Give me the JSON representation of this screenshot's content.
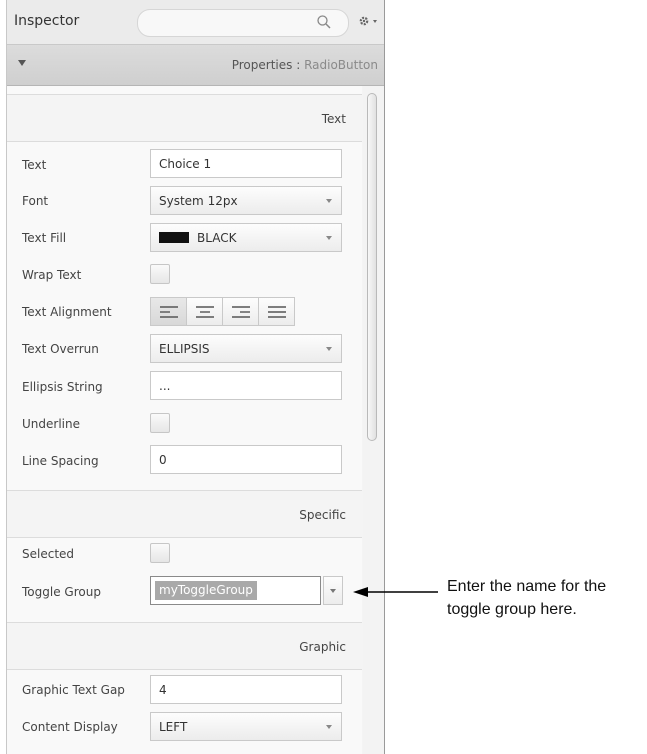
{
  "header": {
    "title": "Inspector",
    "search_icon": "magnifier",
    "settings_icon": "gear-with-dropdown"
  },
  "properties_bar": {
    "label": "Properties :",
    "type": "RadioButton"
  },
  "sections": {
    "text": {
      "title": "Text",
      "rows": {
        "text": {
          "label": "Text",
          "value": "Choice 1"
        },
        "font": {
          "label": "Font",
          "value": "System 12px"
        },
        "text_fill": {
          "label": "Text Fill",
          "value": "BLACK",
          "swatch_color": "#111111"
        },
        "wrap_text": {
          "label": "Wrap Text"
        },
        "text_alignment": {
          "label": "Text Alignment",
          "options": [
            "left",
            "center",
            "right",
            "justify"
          ],
          "selected": "left"
        },
        "text_overrun": {
          "label": "Text Overrun",
          "value": "ELLIPSIS"
        },
        "ellipsis_string": {
          "label": "Ellipsis String",
          "value": "..."
        },
        "underline": {
          "label": "Underline"
        },
        "line_spacing": {
          "label": "Line Spacing",
          "value": "0"
        }
      }
    },
    "specific": {
      "title": "Specific",
      "rows": {
        "selected": {
          "label": "Selected"
        },
        "toggle_group": {
          "label": "Toggle Group",
          "value": "myToggleGroup"
        }
      }
    },
    "graphic": {
      "title": "Graphic",
      "rows": {
        "graphic_text_gap": {
          "label": "Graphic Text Gap",
          "value": "4"
        },
        "content_display": {
          "label": "Content Display",
          "value": "LEFT"
        }
      }
    }
  },
  "annotation": {
    "line1": "Enter the name for the",
    "line2": "toggle group here."
  }
}
